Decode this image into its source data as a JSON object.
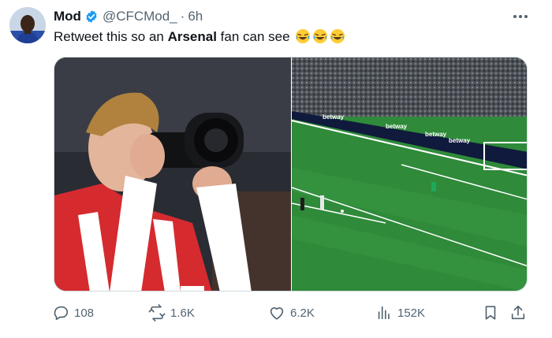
{
  "author": {
    "display_name": "Mod",
    "handle": "@CFCMod_",
    "separator": "·",
    "time": "6h"
  },
  "tweet": {
    "text_before": "Retweet this so an ",
    "text_bold": "Arsenal",
    "text_after": " fan can see",
    "emoji": "face-with-tears-of-joy x3"
  },
  "media": {
    "left_photo": "player holding camera to face",
    "right_photo": "penalty kick in stadium",
    "ad_board_text": "betway"
  },
  "actions": {
    "replies": "108",
    "retweets": "1.6K",
    "likes": "6.2K",
    "views": "152K"
  },
  "colors": {
    "text": "#0f1419",
    "secondary": "#536471",
    "verified": "#1d9bf0",
    "pitch": "#2f8a3a",
    "arsenal_red": "#d52b2f"
  }
}
